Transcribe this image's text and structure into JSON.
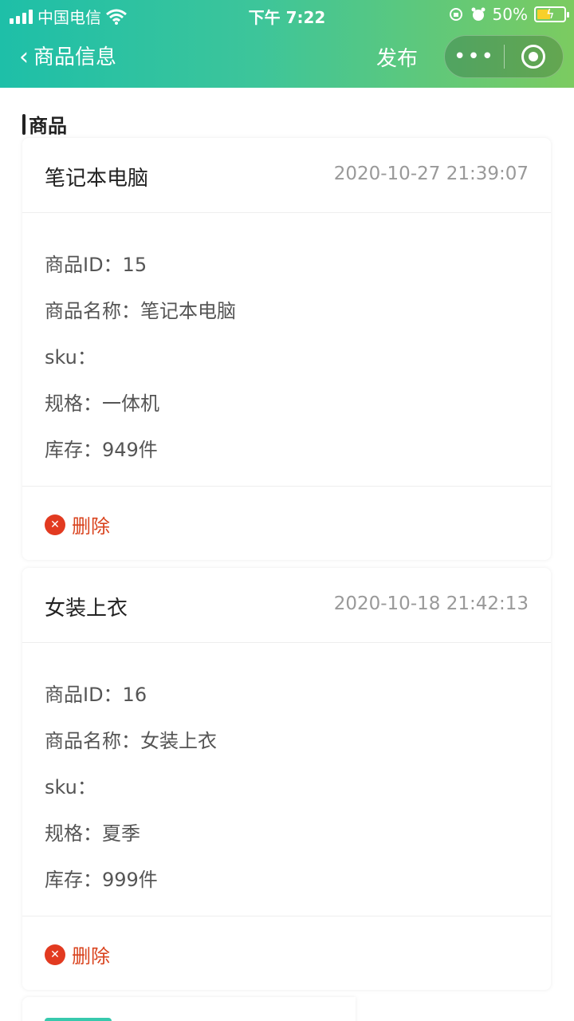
{
  "status": {
    "carrier": "中国电信",
    "time": "下午 7:22",
    "battery": "50%"
  },
  "nav": {
    "back_label": "商品信息",
    "publish_label": "发布"
  },
  "section": {
    "title": "商品"
  },
  "products": [
    {
      "name": "笔记本电脑",
      "time": "2020-10-27 21:39:07",
      "id_line": "商品ID：15",
      "name_line": "商品名称：笔记本电脑",
      "sku_line": "sku：",
      "spec_line": "规格：一体机",
      "stock_line": "库存：949件",
      "delete_label": "删除"
    },
    {
      "name": "女装上衣",
      "time": "2020-10-18 21:42:13",
      "id_line": "商品ID：16",
      "name_line": "商品名称：女装上衣",
      "sku_line": "sku：",
      "spec_line": "规格：夏季",
      "stock_line": "库存：999件",
      "delete_label": "删除"
    }
  ],
  "colors": {
    "header_start": "#1ebfa8",
    "header_end": "#7ccb60",
    "delete": "#e23a20"
  }
}
